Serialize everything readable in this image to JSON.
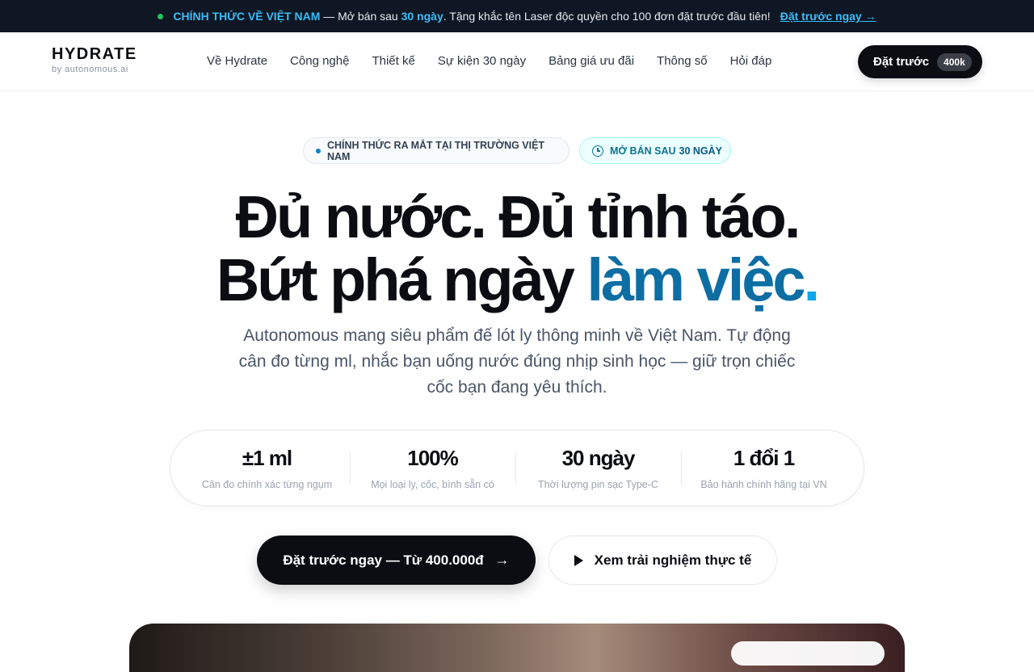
{
  "announcement": {
    "highlight": "CHÍNH THỨC VỀ VIỆT NAM",
    "text_before_days": "— Mở bán sau",
    "days": "30 ngày",
    "text_after_days": ". Tặng khắc tên Laser độc quyền cho 100 đơn đặt trước đầu tiên!",
    "cta": "Đặt trước ngay →"
  },
  "nav": {
    "logo": "HYDRATE",
    "logo_sub": "by autonomous.ai",
    "menu": [
      "Về Hydrate",
      "Công nghệ",
      "Thiết kế",
      "Sự kiện 30 ngày",
      "Bảng giá ưu đãi",
      "Thông số",
      "Hỏi đáp"
    ],
    "preorder_label": "Đặt trước",
    "preorder_badge": "400k"
  },
  "pills": {
    "launch": "CHÍNH THỨC RA MẮT TẠI THỊ TRƯỜNG VIỆT NAM",
    "sale_prefix": "MỞ BÁN SAU",
    "sale_days": "30 NGÀY"
  },
  "headline": {
    "line1": "Đủ nước. Đủ tỉnh táo.",
    "line2_start": "Bứt phá ngày ",
    "line2_blue": "làm việc",
    "line2_dot": "."
  },
  "subtitle": "Autonomous mang siêu phẩm đế lót ly thông minh về Việt Nam. Tự động cân đo từng ml, nhắc bạn uống nước đúng nhịp sinh học — giữ trọn chiếc cốc bạn đang yêu thích.",
  "stats": [
    {
      "value": "±1 ml",
      "label": "Cân đo chính xác từng ngụm"
    },
    {
      "value": "100%",
      "label": "Mọi loại ly, cốc, bình sẵn có"
    },
    {
      "value": "30 ngày",
      "label": "Thời lượng pin sạc Type-C"
    },
    {
      "value": "1 đổi 1",
      "label": "Bảo hành chính hãng tại VN"
    }
  ],
  "cta": {
    "primary": "Đặt trước ngay — Từ 400.000đ",
    "primary_arrow": "→",
    "secondary": "Xem trải nghiệm thực tế"
  },
  "colors": {
    "accent": "#0d6ea3",
    "announce_bg": "#0f1724",
    "highlight": "#38bdf8"
  }
}
